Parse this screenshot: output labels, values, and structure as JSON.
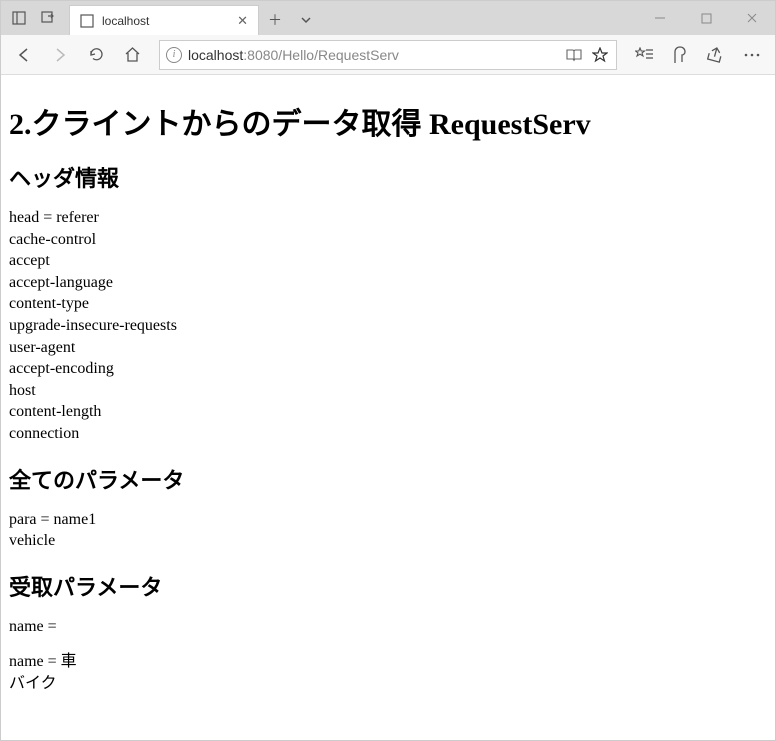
{
  "titlebar": {
    "tab_title": "localhost"
  },
  "toolbar": {
    "url_host": "localhost",
    "url_rest": ":8080/Hello/RequestServ"
  },
  "page": {
    "h1": "2.クライントからのデータ取得 RequestServ",
    "sections": {
      "headers": {
        "title": "ヘッダ情報",
        "lines": [
          "head = referer",
          "cache-control",
          "accept",
          "accept-language",
          "content-type",
          "upgrade-insecure-requests",
          "user-agent",
          "accept-encoding",
          "host",
          "content-length",
          "connection"
        ]
      },
      "params_all": {
        "title": "全てのパラメータ",
        "lines": [
          "para = name1",
          "vehicle"
        ]
      },
      "params_recv": {
        "title": "受取パラメータ",
        "para1": "name =",
        "para2_lines": [
          "name = 車",
          "バイク"
        ]
      }
    }
  }
}
